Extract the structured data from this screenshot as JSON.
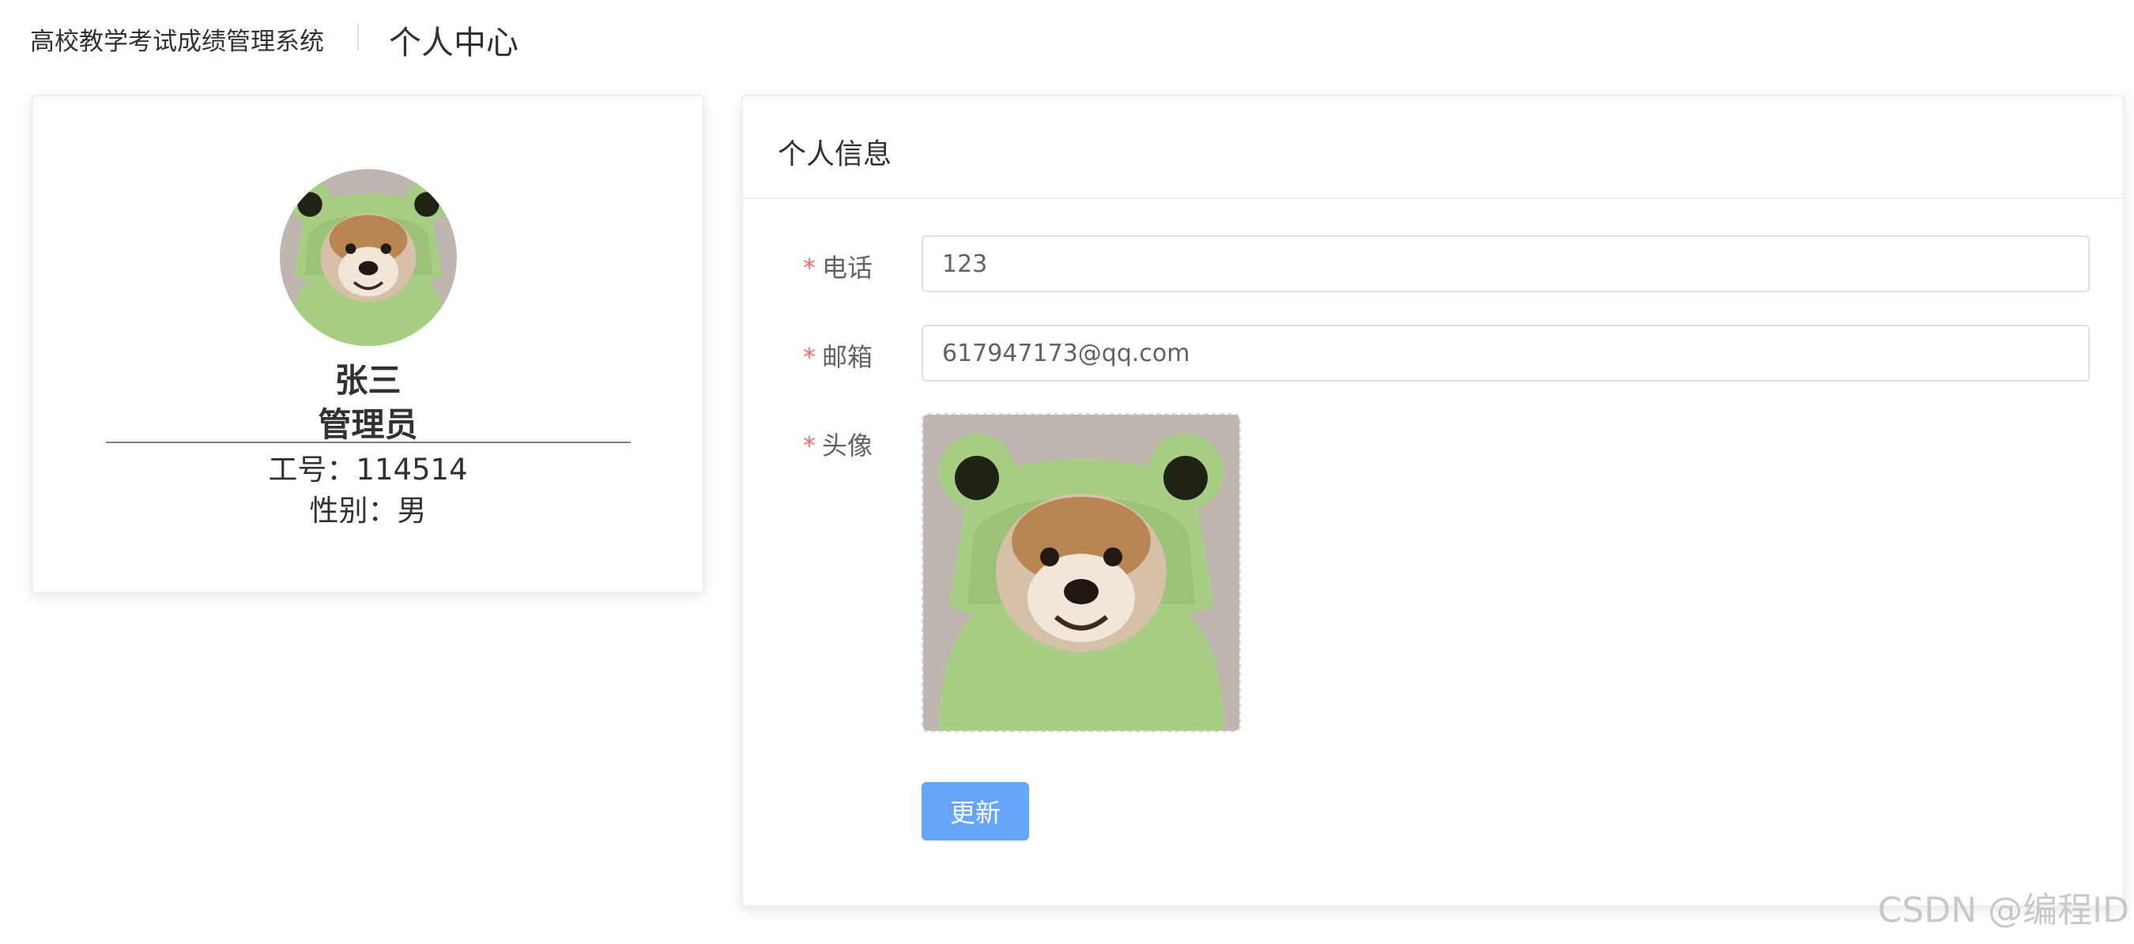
{
  "header": {
    "app_title": "高校教学考试成绩管理系统",
    "page_title": "个人中心"
  },
  "profile": {
    "name": "张三",
    "role": "管理员",
    "employee_id": "工号：114514",
    "gender": "性别：男",
    "avatar_icon": "dog-in-frog-hood-avatar"
  },
  "info_card": {
    "title": "个人信息",
    "required_mark": "*",
    "fields": {
      "phone": {
        "label": "电话",
        "value": "123"
      },
      "email": {
        "label": "邮箱",
        "value": "617947173@qq.com"
      },
      "avatar": {
        "label": "头像"
      }
    },
    "update_button": "更新"
  },
  "watermark": "CSDN @编程ID",
  "colors": {
    "primary_button": "#66a6f8",
    "required": "#f56c6c",
    "border": "#dcdfe6",
    "hood_green": "#a7cf84"
  }
}
